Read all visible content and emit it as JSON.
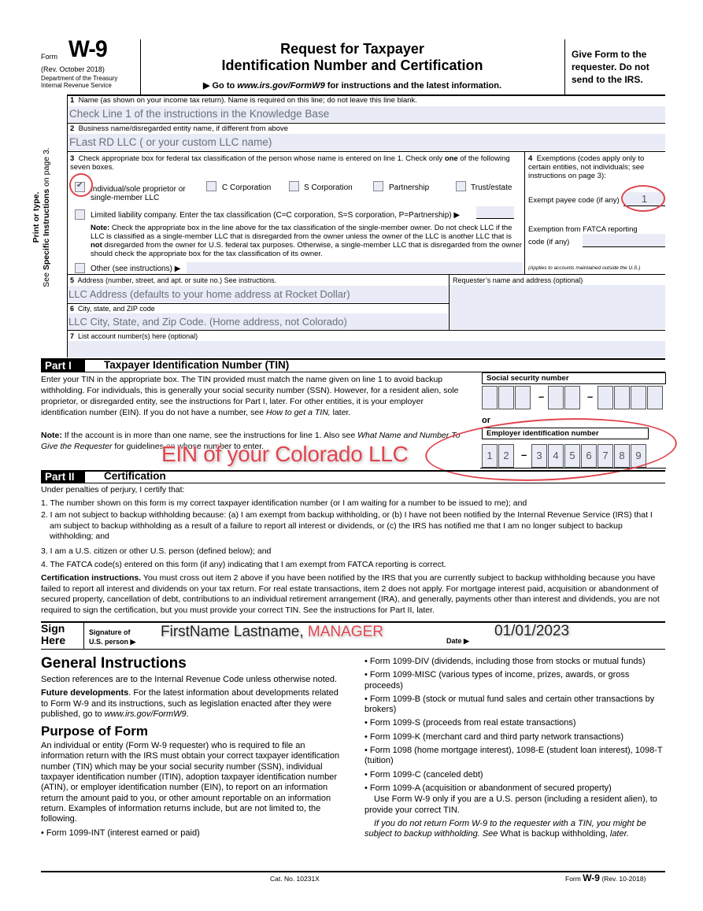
{
  "header": {
    "form_word": "Form",
    "form_number": "W-9",
    "revision": "(Rev. October 2018)",
    "dept_line1": "Department of the Treasury",
    "dept_line2": "Internal Revenue Service",
    "title_line1": "Request for Taxpayer",
    "title_line2": "Identification Number and Certification",
    "goto_prefix": "▶ Go to ",
    "goto_url": "www.irs.gov/FormW9",
    "goto_suffix": " for instructions and the latest information.",
    "give_form": "Give Form to the requester. Do not send to the IRS."
  },
  "side_label": {
    "line1": "Print or type.",
    "line2_prefix": "See ",
    "line2_bold": "Specific Instructions",
    "line2_suffix": " on page 3."
  },
  "line1": {
    "label_num": "1",
    "label": "Name (as shown on your income tax return). Name is required on this line; do not leave this line blank.",
    "value": "Check Line 1 of the instructions in the Knowledge Base"
  },
  "line2": {
    "label_num": "2",
    "label": "Business name/disregarded entity name, if different from above",
    "value": "FLast RD LLC ( or your custom LLC name)"
  },
  "line3": {
    "label_num": "3",
    "label_a": "Check appropriate box for federal tax classification of the person whose name is entered on line 1. Check only ",
    "label_bold": "one",
    "label_b": " of the following seven boxes.",
    "options": [
      {
        "label": "Individual/sole proprietor or single-member LLC",
        "checked": true
      },
      {
        "label": "C Corporation",
        "checked": false
      },
      {
        "label": "S Corporation",
        "checked": false
      },
      {
        "label": "Partnership",
        "checked": false
      },
      {
        "label": "Trust/estate",
        "checked": false
      }
    ],
    "llc_label": "Limited liability company. Enter the tax classification (C=C corporation, S=S corporation, P=Partnership) ▶",
    "llc_value": "",
    "note_bold": "Note:",
    "note_a": " Check the appropriate box in the line above for the tax classification of the single-member owner.  Do not check LLC if the LLC is classified as a single-member LLC that is disregarded from the owner unless the owner of the LLC is another LLC that is ",
    "note_not": "not",
    "note_b": " disregarded from the owner for U.S. federal tax purposes. Otherwise, a single-member LLC that is disregarded from the owner should check the appropriate box for the tax classification of its owner.",
    "other_label": "Other (see instructions) ▶",
    "other_value": "",
    "check_mark": "✔"
  },
  "line4": {
    "label_num": "4",
    "label": "Exemptions (codes apply only to certain entities, not individuals; see instructions on page 3):",
    "exempt_payee_label": "Exempt payee code (if any)",
    "exempt_payee_value": "1",
    "fatca_label1": "Exemption from FATCA reporting",
    "fatca_label2": "code (if any)",
    "fatca_value": "",
    "applies_note": "(Applies to accounts maintained outside the U.S.)"
  },
  "line5": {
    "label_num": "5",
    "label": "Address (number, street, and apt. or suite no.) See instructions.",
    "value": "LLC Address (defaults to your home address at Rocket Dollar)"
  },
  "requester": {
    "label": "Requester’s name and address (optional)",
    "value": ""
  },
  "line6": {
    "label_num": "6",
    "label": "City, state, and ZIP code",
    "value": "LLC City, State, and Zip Code. (Home address, not Colorado)"
  },
  "line7": {
    "label_num": "7",
    "label": "List account number(s) here (optional)",
    "value": ""
  },
  "part1": {
    "tag": "Part I",
    "title": "Taxpayer Identification Number (TIN)",
    "para1_a": "Enter your TIN in the appropriate box. The TIN provided must match the name given on line 1 to avoid backup withholding. For individuals, this is generally your social security number (SSN). However, for a resident alien, sole proprietor, or disregarded entity, see the instructions for Part I, later. For other entities, it is your employer identification number (EIN). If you do not have a number, see ",
    "para1_ital": "How to get a TIN,",
    "para1_b": " later.",
    "note_bold": "Note:",
    "note_a": " If the account is in more than one name, see the instructions for line 1. Also see ",
    "note_ital": "What Name and Number To Give the Requester",
    "note_b": " for guidelines on whose number to enter.",
    "ssn_label": "Social security number",
    "ssn_digits": [
      "",
      "",
      "",
      "",
      "",
      "",
      "",
      "",
      ""
    ],
    "or_label": "or",
    "ein_label": "Employer identification number",
    "ein_digits": [
      "1",
      "2",
      "3",
      "4",
      "5",
      "6",
      "7",
      "8",
      "9"
    ],
    "dash": "–"
  },
  "part2": {
    "tag": "Part II",
    "title": "Certification",
    "intro": "Under penalties of perjury, I certify that:",
    "items": [
      "1. The number shown on this form is my correct taxpayer identification number (or I am waiting for a number to be issued to me); and",
      "2. I am not subject to backup withholding because: (a) I am exempt from backup withholding, or (b) I have not been notified by the Internal Revenue Service (IRS) that I am subject to backup withholding as a result of a failure to report all interest or dividends, or (c) the IRS has notified me that I am no longer subject to backup withholding; and",
      "3. I am a U.S. citizen or other U.S. person (defined below); and",
      "4. The FATCA code(s) entered on this form (if any) indicating that I am exempt from FATCA reporting is correct."
    ],
    "cert_bold": "Certification instructions.",
    "cert_text": " You must cross out item 2 above if you have been notified by the IRS that you are currently subject to backup withholding because you have failed to report all interest and dividends on your tax return. For real estate transactions, item 2 does not apply. For mortgage interest paid, acquisition or abandonment of secured property, cancellation of debt, contributions to an individual retirement arrangement (IRA), and generally, payments other than interest and dividends, you are not required to sign the certification, but you must provide your correct TIN. See the instructions for Part II, later."
  },
  "sign": {
    "sign_here_1": "Sign",
    "sign_here_2": "Here",
    "sig_label_1": "Signature of",
    "sig_label_2": "U.S. person ▶",
    "signature_name": "FirstName Lastname, ",
    "signature_title": "MANAGER",
    "date_label": "Date ▶",
    "date_value": "01/01/2023"
  },
  "annotations": {
    "ein_callout": "EIN of your Colorado LLC",
    "accent_red": "#e0454e"
  },
  "general": {
    "h1": "General Instructions",
    "p1": "Section references are to the Internal Revenue Code unless otherwise noted.",
    "fd_bold": "Future developments",
    "fd_text": ". For the latest information about developments related to Form W-9 and its instructions, such as legislation enacted after they were published, go to ",
    "fd_url": "www.irs.gov/FormW9",
    "fd_end": ".",
    "h2": "Purpose of Form",
    "purpose": "An individual or entity (Form W-9 requester) who is required to file an information return with the IRS must obtain your correct taxpayer identification number (TIN) which may be your social security number (SSN), individual taxpayer identification number (ITIN), adoption taxpayer identification number (ATIN), or employer identification number (EIN), to report on an information return the amount paid to you, or other amount reportable on an information return. Examples of information returns include, but are not limited to, the following.",
    "left_bullet": "• Form 1099-INT (interest earned or paid)",
    "right_bullets": [
      "• Form 1099-DIV (dividends, including those from stocks or mutual funds)",
      "• Form 1099-MISC (various types of income, prizes, awards, or gross proceeds)",
      "• Form 1099-B (stock or mutual fund sales and certain other transactions by brokers)",
      "• Form 1099-S (proceeds from real estate transactions)",
      "• Form 1099-K (merchant card and third party network transactions)",
      "• Form 1098 (home mortgage interest), 1098-E (student loan interest), 1098-T (tuition)",
      "• Form 1099-C (canceled debt)",
      "• Form 1099-A (acquisition or abandonment of secured property)"
    ],
    "use_para": "Use Form W-9 only if you are a U.S. person (including a resident alien), to provide your correct TIN.",
    "warn_ital": "If you do not return Form W-9 to the requester with a TIN, you might be subject to backup withholding. See ",
    "warn_plain": "What is backup withholding,",
    "warn_end": " later."
  },
  "footer": {
    "cat_no": "Cat. No. 10231X",
    "form_prefix": "Form ",
    "form_num": "W-9",
    "rev": " (Rev. 10-2018)"
  }
}
